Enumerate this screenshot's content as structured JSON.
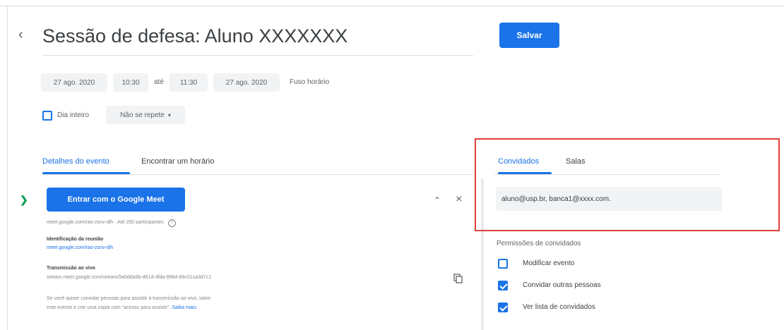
{
  "header": {
    "back_icon": "chevron-left-icon",
    "title": "Sessão de defesa: Aluno XXXXXXX",
    "save_label": "Salvar"
  },
  "datetime": {
    "start_date": "27 ago. 2020",
    "start_time": "10:30",
    "separator": "até",
    "end_time": "11:30",
    "end_date": "27 ago. 2020",
    "timezone": "Fuso horário"
  },
  "options": {
    "all_day_label": "Dia inteiro",
    "all_day_checked": false,
    "repeat_label": "Não se repete",
    "repeat_icon": "caret-down-icon"
  },
  "left_tabs": {
    "event_details": "Detalhes do evento",
    "find_time": "Encontrar um horário"
  },
  "meet": {
    "icon": "google-meet-icon",
    "join_label": "Entrar com o Google Meet",
    "link_line": "meet.google.com/rao-zsnv-dih · Até 250 participantes",
    "help_icon": "help-circle-icon",
    "meeting_id_label": "Identificação da reunião",
    "meeting_id_value": "meet.google.com/rao-zsnv-dih",
    "livestream_label": "Transmissão ao vivo",
    "livestream_value": "stream.meet.google.com/stream/5a0dda9b-d61d-4fda-9984-86c01ca3d7c1",
    "note_line1": "Se você quiser convidar pessoas para assistir à transmissão ao vivo, salve",
    "note_line2": "este evento e crie uma cópia com \"acesso para assistir\".",
    "learn_more": "Saiba mais",
    "collapse_icon": "chevron-up-icon",
    "remove_icon": "close-icon",
    "copy_icon": "copy-icon"
  },
  "right_tabs": {
    "guests": "Convidados",
    "rooms": "Salas"
  },
  "guests": {
    "input_value": "aluno@usp.br, banca1@xxxx.com."
  },
  "permissions": {
    "title": "Permissões de convidados",
    "items": [
      {
        "label": "Modificar evento",
        "checked": false
      },
      {
        "label": "Convidar outras pessoas",
        "checked": true
      },
      {
        "label": "Ver lista de convidados",
        "checked": true
      }
    ]
  },
  "colors": {
    "accent": "#1a73e8",
    "highlight_box": "#e0403a"
  }
}
